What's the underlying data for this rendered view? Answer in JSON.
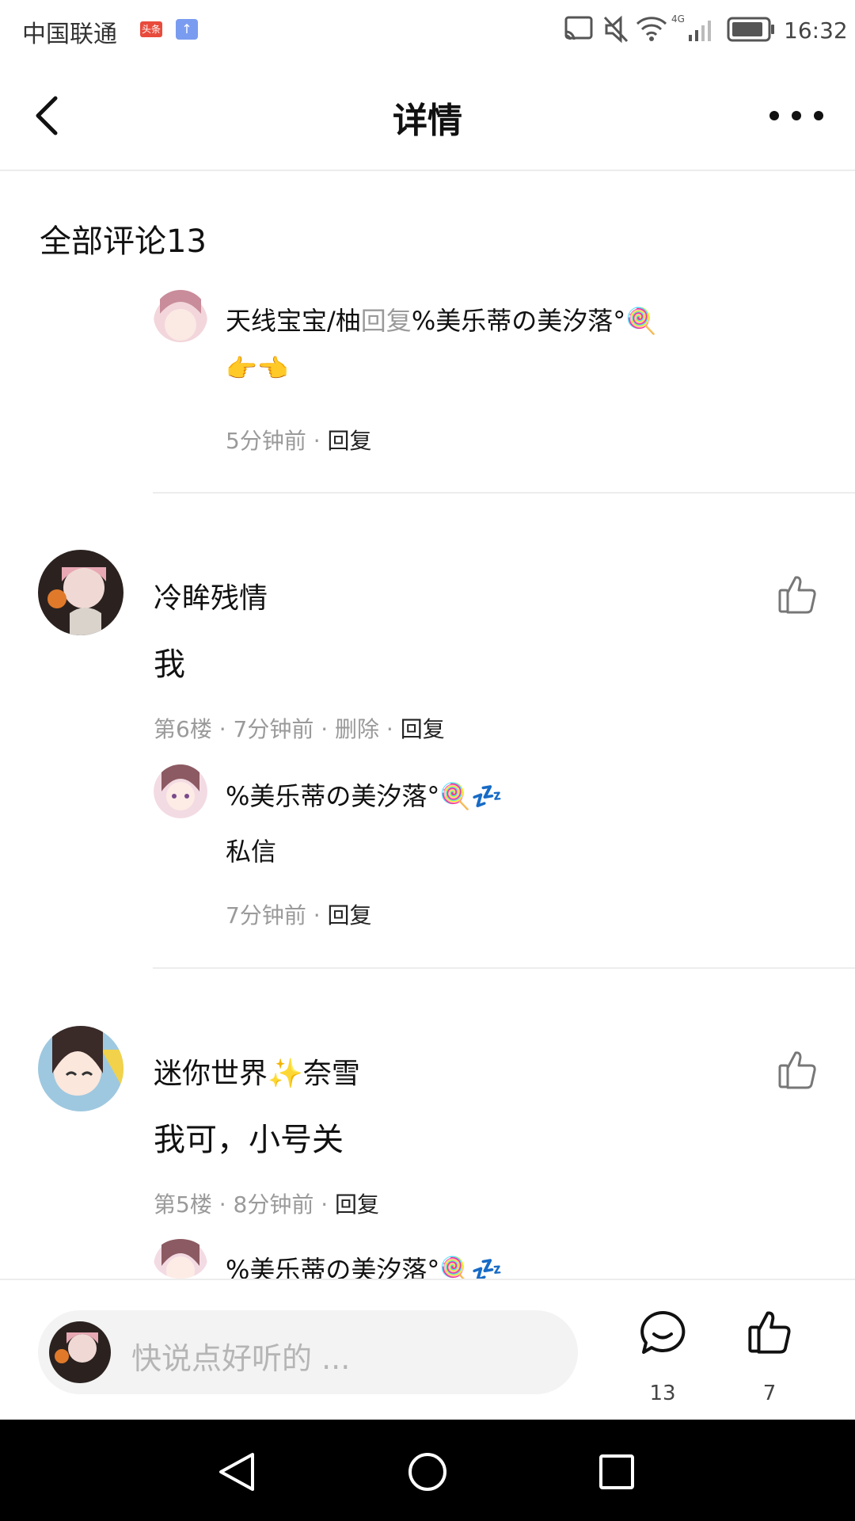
{
  "status_bar": {
    "carrier": "中国联通",
    "badge": "头条",
    "time": "16:32"
  },
  "header": {
    "title": "详情"
  },
  "section_title": "全部评论13",
  "top_reply": {
    "author": "天线宝宝/柚",
    "reply_word": "回复",
    "target": "%美乐蒂の美汐落°🍭",
    "text": "👉👈",
    "time": "5分钟前",
    "reply_label": "回复"
  },
  "comments": [
    {
      "name": "冷眸残情",
      "text": "我",
      "meta": "第6楼 · 7分钟前 · 删除 · ",
      "reply_label": "回复",
      "reply": {
        "name": "%美乐蒂の美汐落°🍭💤",
        "text": "私信",
        "time": "7分钟前 · ",
        "reply_label": "回复"
      }
    },
    {
      "name": "迷你世界✨奈雪",
      "text": "我可，小号关",
      "meta": "第5楼 · 8分钟前 · ",
      "reply_label": "回复",
      "reply": {
        "name": "%美乐蒂の美汐落°🍭💤"
      }
    }
  ],
  "bottom_bar": {
    "placeholder": "快说点好听的 ...",
    "comment_count": "13",
    "like_count": "7"
  },
  "colors": {
    "divider": "#ededed",
    "meta_gray": "#9a9a9a",
    "nav_bg": "#000000"
  }
}
